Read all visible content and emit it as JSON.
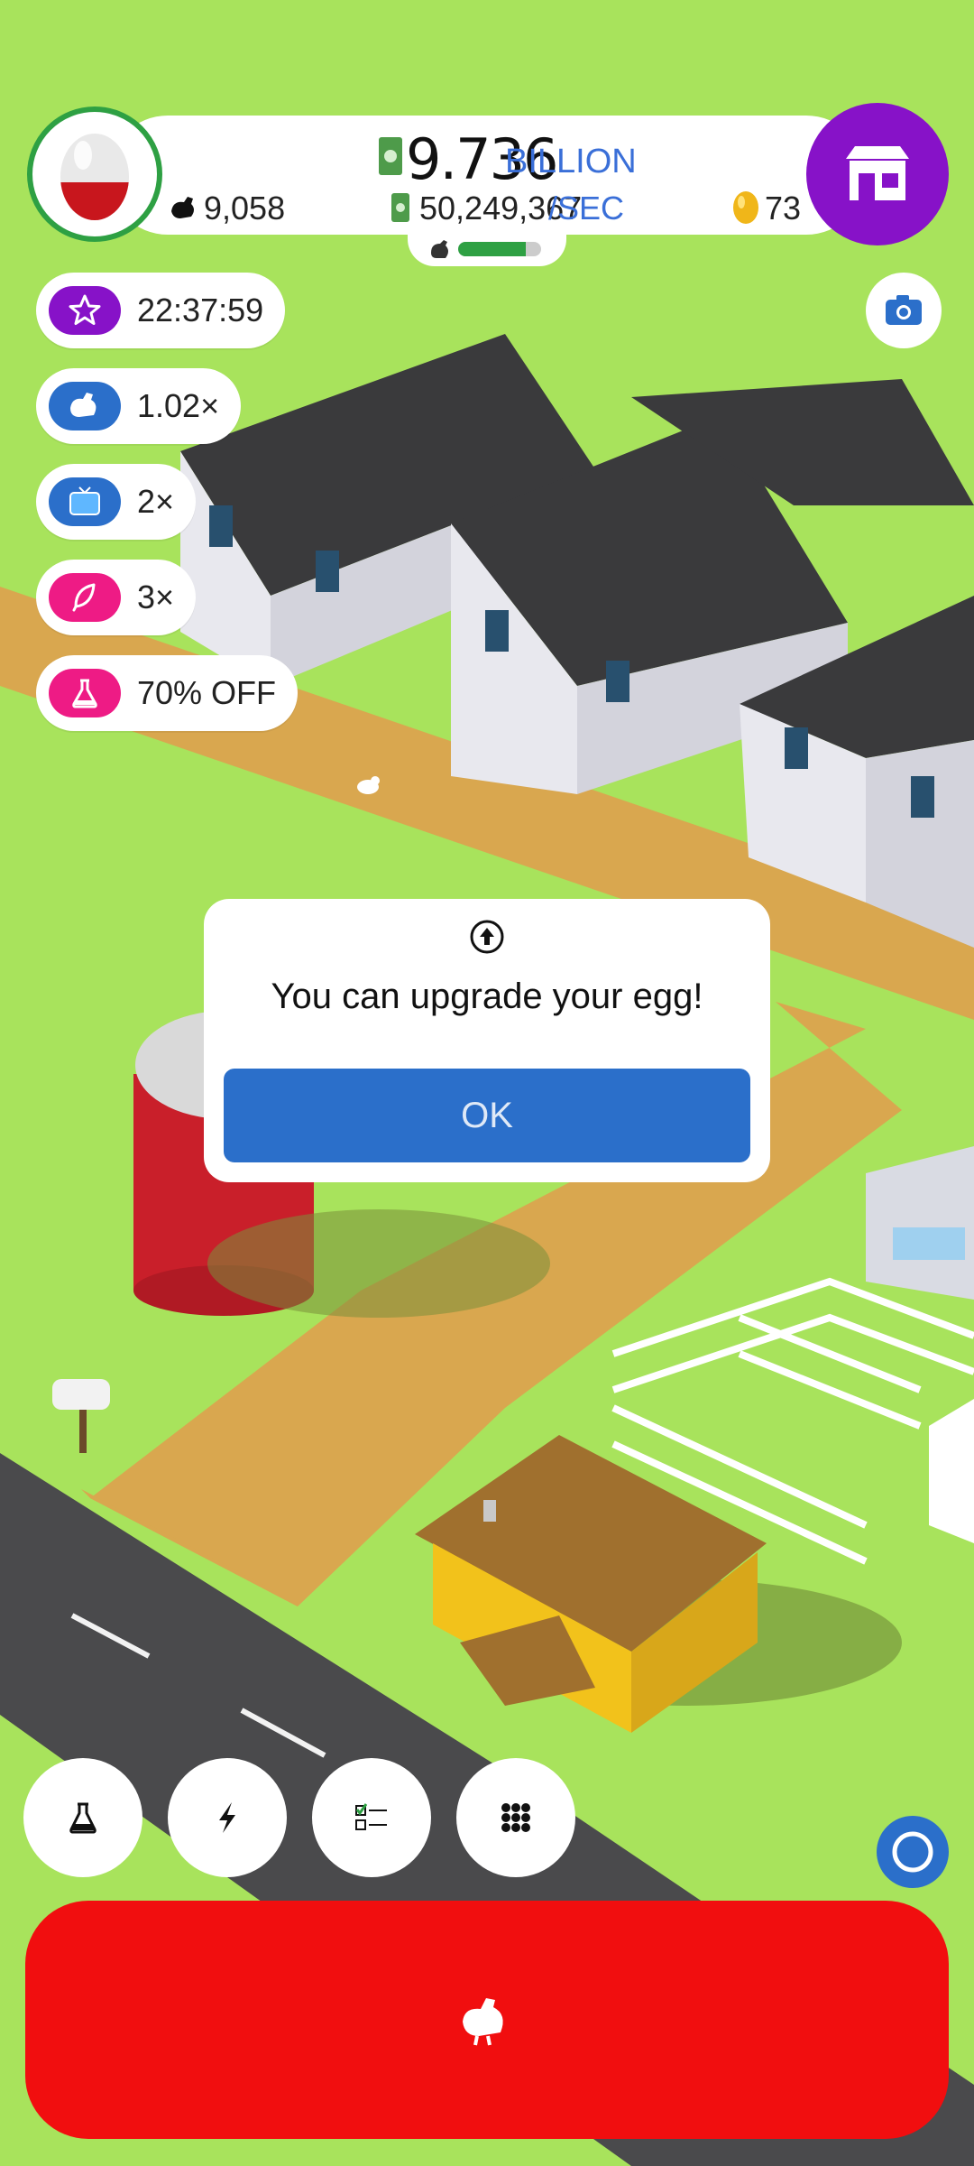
{
  "hud": {
    "money_value": "9.736",
    "money_unit": "BILLION",
    "rate_value": "50,249,367",
    "rate_unit": "/SEC",
    "chicken_count": "9,058",
    "gem_count": "73",
    "hatchery_fill_fraction": 0.82
  },
  "boosts": [
    {
      "icon": "star-icon",
      "label": "22:37:59",
      "color": "#8712c8"
    },
    {
      "icon": "chicken-icon",
      "label": "1.02×",
      "color": "#2b6fca"
    },
    {
      "icon": "tv-icon",
      "label": "2×",
      "color": "#2b6fca"
    },
    {
      "icon": "feather-icon",
      "label": "3×",
      "color": "#ee1b85"
    },
    {
      "icon": "flask-icon",
      "label": "70% OFF",
      "color": "#ee1b85"
    }
  ],
  "dialog": {
    "icon": "upgrade-arrow-icon",
    "message": "You can upgrade your egg!",
    "ok_label": "OK"
  },
  "bottom_bar": {
    "buttons": [
      "research-flask-icon",
      "boost-lightning-icon",
      "missions-checklist-icon",
      "menu-grid-icon"
    ],
    "hatch_icon": "chicken-icon"
  },
  "colors": {
    "grass": "#a8e35c",
    "road": "#4a4a4c",
    "path": "#d9a74f",
    "hatch_button": "#f10e0f",
    "shop_button": "#8712c8",
    "accent_blue": "#2b6fca"
  }
}
